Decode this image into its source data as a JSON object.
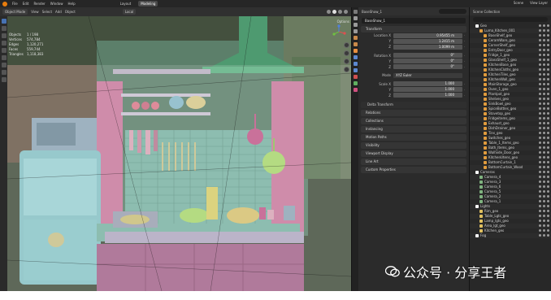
{
  "menubar": {
    "items": [
      "File",
      "Edit",
      "Render",
      "Window",
      "Help"
    ],
    "tabs": [
      "Layout",
      "Modeling"
    ],
    "active_tab": "Modeling",
    "scene": "Scene",
    "view_layer": "View Layer"
  },
  "viewport_header": {
    "mode": "Object Mode",
    "menus": [
      "View",
      "Select",
      "Add",
      "Object"
    ],
    "transform": "Local",
    "options": "Options"
  },
  "stats": [
    {
      "label": "Objects",
      "value": "1 / 198"
    },
    {
      "label": "Vertices",
      "value": "574,784"
    },
    {
      "label": "Edges",
      "value": "1,120,271"
    },
    {
      "label": "Faces",
      "value": "559,744"
    },
    {
      "label": "Triangles",
      "value": "1,118,383"
    }
  ],
  "properties": {
    "object_name": "BaseShow_1",
    "object_field": "BaseShow_1",
    "transform_title": "Transform",
    "location": [
      {
        "label": "Location X",
        "value": "0.95455 m"
      },
      {
        "label": "Y",
        "value": "1.2415 m"
      },
      {
        "label": "Z",
        "value": "1.0099 m"
      }
    ],
    "rotation": [
      {
        "label": "Rotation X",
        "value": "0°"
      },
      {
        "label": "Y",
        "value": "0°"
      },
      {
        "label": "Z",
        "value": "0°"
      }
    ],
    "mode": {
      "label": "Mode",
      "value": "XYZ Euler"
    },
    "scale": [
      {
        "label": "Scale X",
        "value": "1.000"
      },
      {
        "label": "Y",
        "value": "1.000"
      },
      {
        "label": "Z",
        "value": "1.000"
      }
    ],
    "panels": [
      "Delta Transform",
      "Relations",
      "Collections",
      "Instancing",
      "Motion Paths",
      "Visibility",
      "Viewport Display",
      "Line Art",
      "Custom Properties"
    ]
  },
  "outliner": {
    "title": "Scene Collection",
    "rows": [
      {
        "name": "Scene Collection",
        "indent": 0,
        "color": "#cccccc"
      },
      {
        "name": "Geo",
        "indent": 1,
        "color": "#ffffff"
      },
      {
        "name": "Luma_Kitchen_001",
        "indent": 2,
        "color": "#e09b3d"
      },
      {
        "name": "BaseShelf_geo",
        "indent": 3,
        "color": "#e09b3d"
      },
      {
        "name": "CeramWare_geo",
        "indent": 3,
        "color": "#e09b3d"
      },
      {
        "name": "CornerShelf_geo",
        "indent": 3,
        "color": "#e09b3d"
      },
      {
        "name": "EntryDoor_geo",
        "indent": 3,
        "color": "#e09b3d"
      },
      {
        "name": "Fridge_1_geo",
        "indent": 3,
        "color": "#e09b3d"
      },
      {
        "name": "GlassShelf_1_geo",
        "indent": 3,
        "color": "#e09b3d"
      },
      {
        "name": "KitchenBase_geo",
        "indent": 3,
        "color": "#e09b3d"
      },
      {
        "name": "KitchenCloths_geo",
        "indent": 3,
        "color": "#e09b3d"
      },
      {
        "name": "KitchenTiles_geo",
        "indent": 3,
        "color": "#e09b3d"
      },
      {
        "name": "KitchenWall_geo",
        "indent": 3,
        "color": "#e09b3d"
      },
      {
        "name": "MainStorage_geo",
        "indent": 3,
        "color": "#e09b3d"
      },
      {
        "name": "Oven_1_geo",
        "indent": 3,
        "color": "#e09b3d"
      },
      {
        "name": "Plantpot_geo",
        "indent": 3,
        "color": "#e09b3d"
      },
      {
        "name": "Shelves_geo",
        "indent": 3,
        "color": "#e09b3d"
      },
      {
        "name": "SinkBowl_geo",
        "indent": 3,
        "color": "#e09b3d"
      },
      {
        "name": "SpiceBottles_geo",
        "indent": 3,
        "color": "#e09b3d"
      },
      {
        "name": "Stovetop_geo",
        "indent": 3,
        "color": "#e09b3d"
      },
      {
        "name": "Fridgeitems_geo",
        "indent": 3,
        "color": "#e09b3d"
      },
      {
        "name": "Exhaust_geo",
        "indent": 3,
        "color": "#e09b3d"
      },
      {
        "name": "DishDrainer_geo",
        "indent": 3,
        "color": "#e09b3d"
      },
      {
        "name": "Tins_geo",
        "indent": 3,
        "color": "#e09b3d"
      },
      {
        "name": "Switches_geo",
        "indent": 3,
        "color": "#e09b3d"
      },
      {
        "name": "Table_1_Items_geo",
        "indent": 3,
        "color": "#e09b3d"
      },
      {
        "name": "Bath_Items_geo",
        "indent": 3,
        "color": "#e09b3d"
      },
      {
        "name": "WallSide_Door_geo",
        "indent": 3,
        "color": "#e09b3d"
      },
      {
        "name": "KitchenUtens_geo",
        "indent": 3,
        "color": "#e09b3d"
      },
      {
        "name": "BottomCurtain_1",
        "indent": 3,
        "color": "#e09b3d"
      },
      {
        "name": "BottomCurtain_Wood",
        "indent": 3,
        "color": "#e09b3d"
      },
      {
        "name": "Cameras",
        "indent": 1,
        "color": "#ffffff"
      },
      {
        "name": "Camera_4",
        "indent": 2,
        "color": "#7fb37f"
      },
      {
        "name": "Camera_3",
        "indent": 2,
        "color": "#7fb37f"
      },
      {
        "name": "Camera_6",
        "indent": 2,
        "color": "#7fb37f"
      },
      {
        "name": "Camera_5",
        "indent": 2,
        "color": "#7fb37f"
      },
      {
        "name": "Camera_2",
        "indent": 2,
        "color": "#7fb37f"
      },
      {
        "name": "Camera_1",
        "indent": 2,
        "color": "#7fb37f"
      },
      {
        "name": "Lights",
        "indent": 1,
        "color": "#ffffff"
      },
      {
        "name": "Rim_geo",
        "indent": 2,
        "color": "#e0c060"
      },
      {
        "name": "Table_Lgts_geo",
        "indent": 2,
        "color": "#e0c060"
      },
      {
        "name": "Lamp_lgts_geo",
        "indent": 2,
        "color": "#e0c060"
      },
      {
        "name": "Area_lgt_geo",
        "indent": 2,
        "color": "#e0c060"
      },
      {
        "name": "Kitchen_geo",
        "indent": 2,
        "color": "#e0c060"
      },
      {
        "name": "Fog",
        "indent": 1,
        "color": "#ffffff"
      }
    ]
  },
  "watermark": {
    "text": "公众号 · 分享王者"
  },
  "colors": {
    "blender_orange": "#e87d0d",
    "active_blue": "#4772b3",
    "viewport_bg": "#44503e"
  }
}
